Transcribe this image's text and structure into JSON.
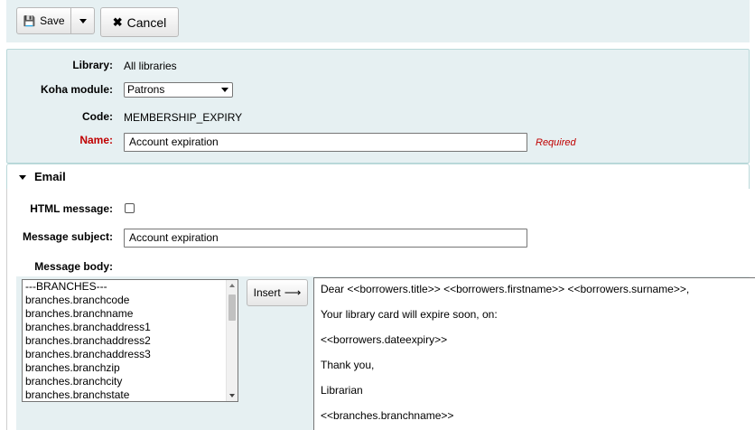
{
  "toolbar": {
    "save_label": "Save",
    "cancel_label": "Cancel"
  },
  "general": {
    "library_label": "Library:",
    "library_value": "All libraries",
    "module_label": "Koha module:",
    "module_selected": "Patrons",
    "code_label": "Code:",
    "code_value": "MEMBERSHIP_EXPIRY",
    "name_label": "Name:",
    "name_value": "Account expiration",
    "required_text": "Required"
  },
  "email": {
    "section_title": "Email",
    "html_message_label": "HTML message:",
    "html_message_checked": false,
    "subject_label": "Message subject:",
    "subject_value": "Account expiration",
    "body_label": "Message body:",
    "insert_label": "Insert",
    "field_options": [
      "---BRANCHES---",
      "branches.branchcode",
      "branches.branchname",
      "branches.branchaddress1",
      "branches.branchaddress2",
      "branches.branchaddress3",
      "branches.branchzip",
      "branches.branchcity",
      "branches.branchstate"
    ],
    "body_lines": [
      "Dear <<borrowers.title>> <<borrowers.firstname>> <<borrowers.surname>>,",
      "Your library card will expire soon, on:",
      "<<borrowers.dateexpiry>>",
      "Thank you,",
      "Librarian",
      "<<branches.branchname>>"
    ]
  },
  "colors": {
    "panel_bg": "#e6f0f2",
    "required_red": "#c00000"
  }
}
